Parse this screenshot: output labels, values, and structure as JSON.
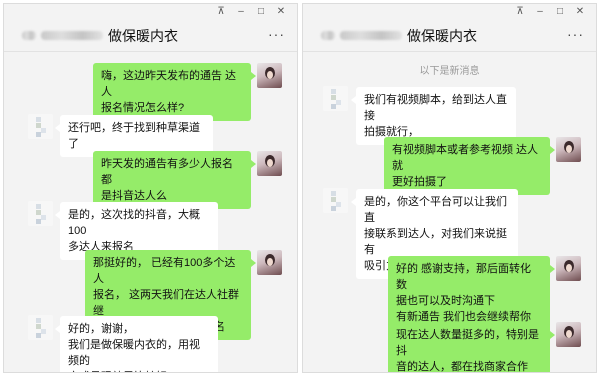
{
  "window_controls": {
    "pin": "⊼",
    "minimize": "–",
    "maximize": "□",
    "close": "✕"
  },
  "more_icon": "···",
  "left": {
    "title": "做保暖内衣",
    "messages": [
      {
        "sender": "me",
        "text": "嗨，这边昨天发布的通告  达人\n报名情况怎么样?"
      },
      {
        "sender": "other",
        "text": "还行吧，终于找到种草渠道了"
      },
      {
        "sender": "me",
        "text": "昨天发的通告有多少人报名  都\n是抖音达人么"
      },
      {
        "sender": "other",
        "text": "是的，这次找的抖音，大概100\n多达人来报名"
      },
      {
        "sender": "me",
        "text": "那挺好的，  已经有100多个达人\n报名，  这两天我们在达人社群继\n续推广下，还会有新的报名"
      },
      {
        "sender": "other",
        "text": "好的，谢谢，\n我们是做保暖内衣的，用视频的\n方式呈现效果比较好"
      }
    ]
  },
  "right": {
    "title": "做保暖内衣",
    "divider": "以下是新消息",
    "messages": [
      {
        "sender": "other",
        "text": "我们有视频脚本，给到达人直接\n拍摄就行，"
      },
      {
        "sender": "me",
        "text": "有视频脚本或者参考视频  达人就\n更好拍摄了"
      },
      {
        "sender": "other",
        "text": "是的，你这个平台可以让我们直\n接联系到达人，对我们来说挺有\n吸引力"
      },
      {
        "sender": "me",
        "text": "好的  感谢支持，那后面转化数\n据也可以及时沟通下\n有新通告  我们也会继续帮你推"
      },
      {
        "sender": "me",
        "text": "现在达人数量挺多的，特别是抖\n音的达人，都在找商家合作"
      }
    ]
  }
}
